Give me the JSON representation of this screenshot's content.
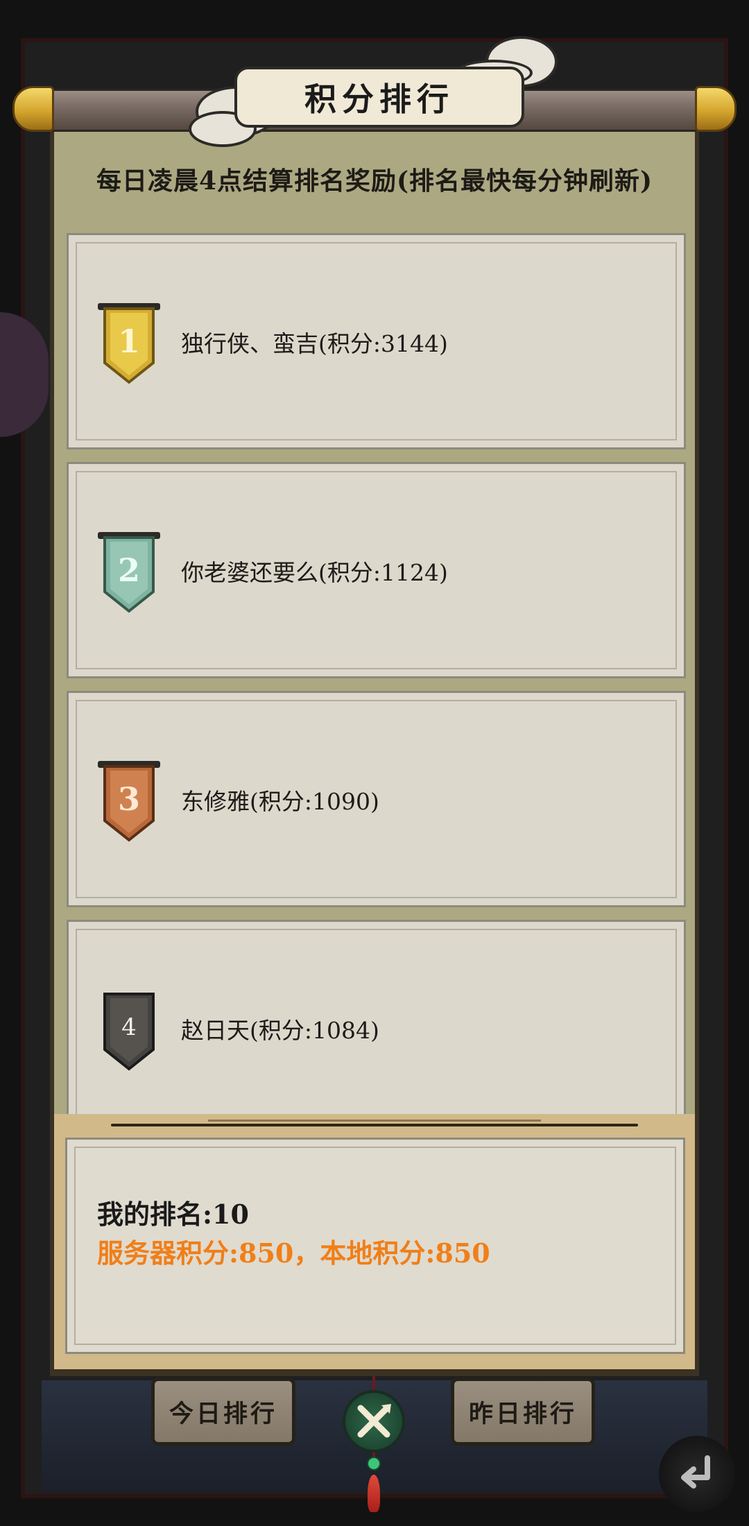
{
  "title": "积分排行",
  "subtitle": "每日凌晨4点结算排名奖励(排名最快每分钟刷新)",
  "rankings": [
    {
      "rank": "1",
      "name_score": "独行侠、蛮吉(积分:3144)",
      "badge_color": "#d4ad32"
    },
    {
      "rank": "2",
      "name_score": "你老婆还要么(积分:1124)",
      "badge_color": "#7fb3a0"
    },
    {
      "rank": "3",
      "name_score": "东修雅(积分:1090)",
      "badge_color": "#b8683a"
    },
    {
      "rank": "4",
      "name_score": "赵日天(积分:1084)",
      "badge_color": "#444240"
    }
  ],
  "my_rank": {
    "rank_text": "我的排名:10",
    "points_text": "服务器积分:850，本地积分:850"
  },
  "buttons": {
    "today": "今日排行",
    "yesterday": "昨日排行"
  },
  "icons": {
    "center_emblem": "crossed-swords-icon",
    "back": "back-arrow-icon"
  },
  "colors": {
    "accent_orange": "#f07f18",
    "parchment": "#aca882",
    "card": "#dcd8cc"
  }
}
